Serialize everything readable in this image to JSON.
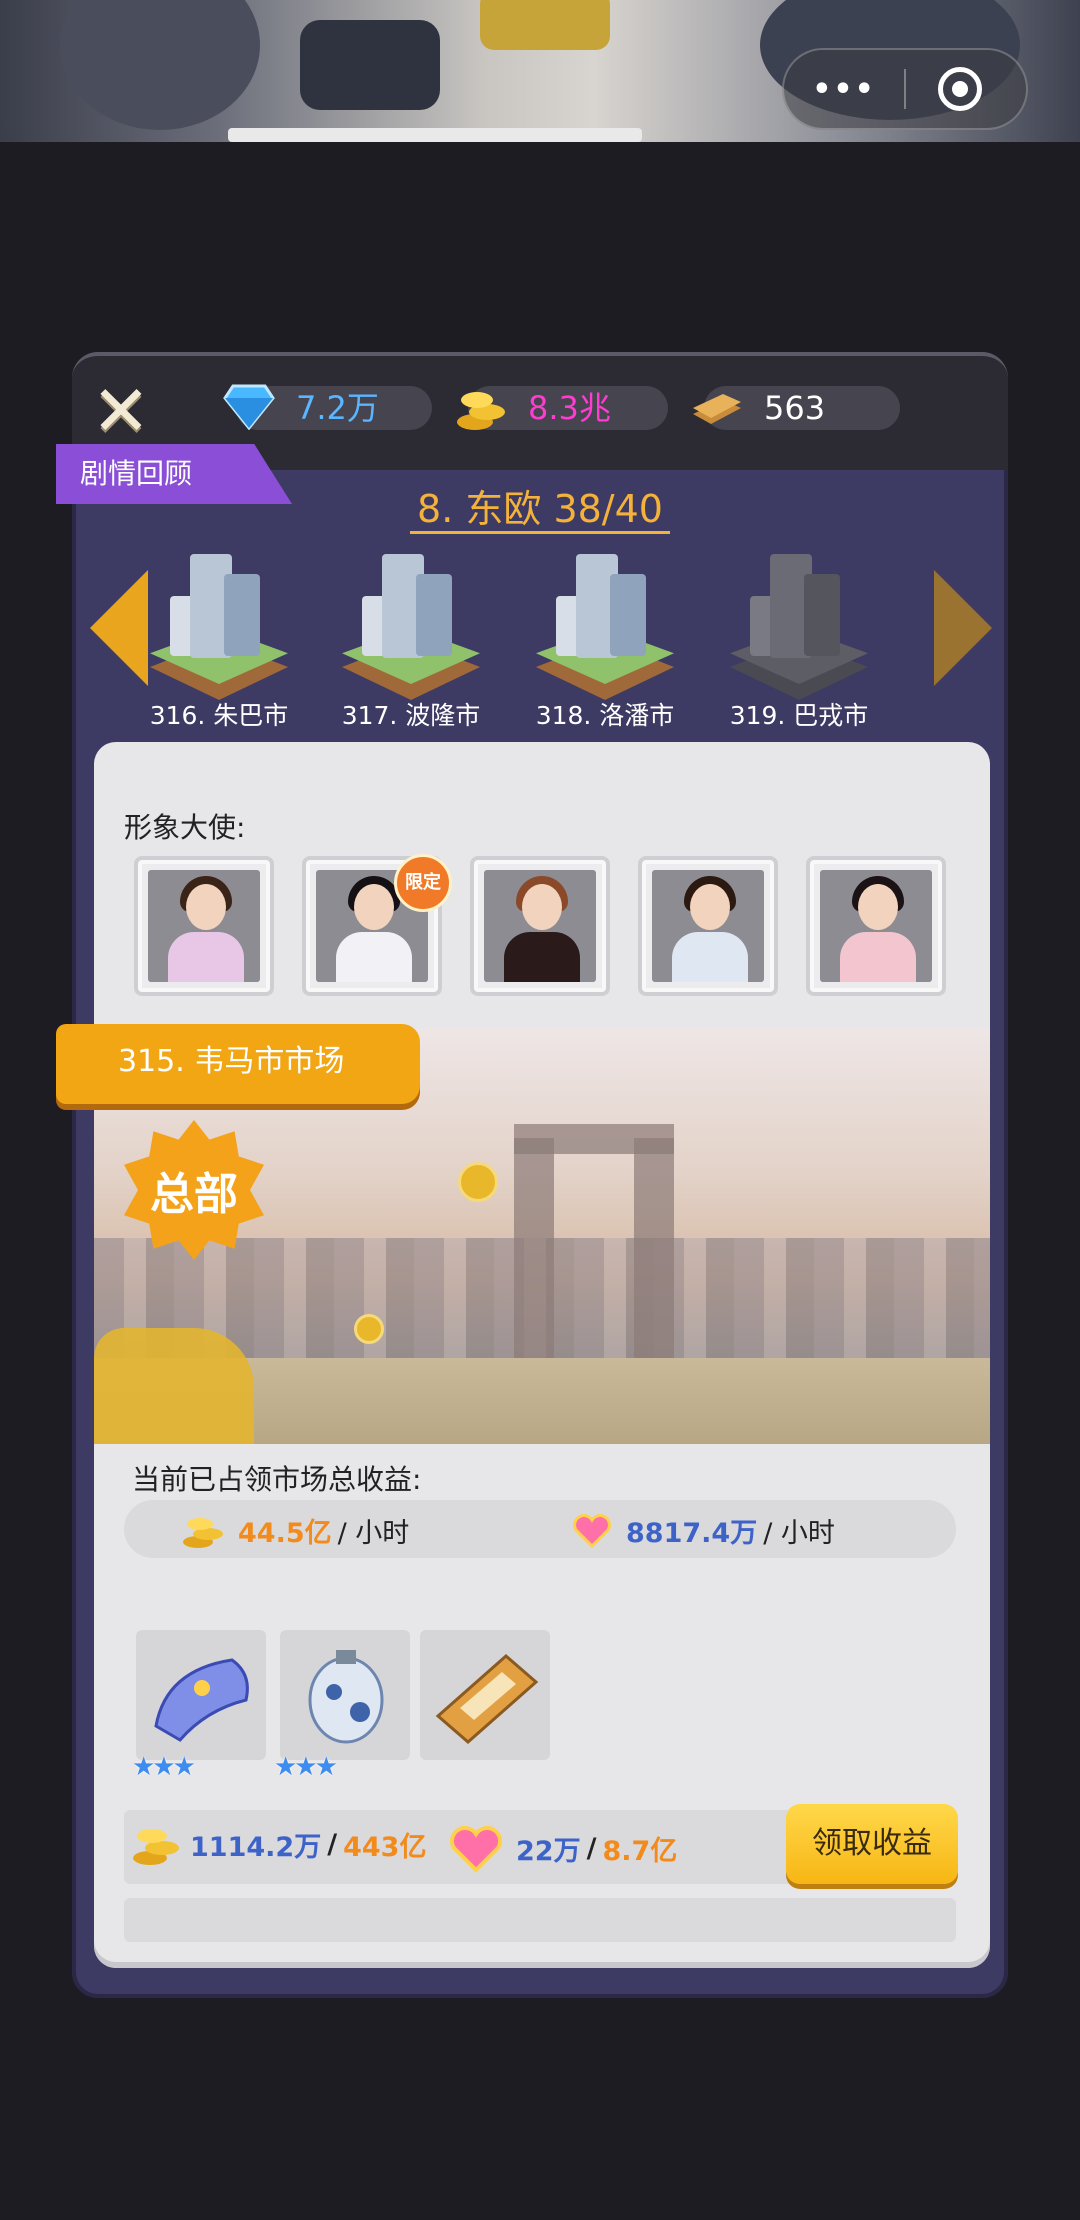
{
  "capsule": {
    "more_label": "•••",
    "icon": "target-icon"
  },
  "resources": {
    "diamond": {
      "icon": "diamond-icon",
      "value": "7.2万"
    },
    "gold": {
      "icon": "gold-coins-icon",
      "value": "8.3兆"
    },
    "ticket": {
      "icon": "gold-bars-icon",
      "value": "563"
    }
  },
  "story_review_label": "剧情回顾",
  "region_title": "8. 东欧 38/40",
  "cities": [
    {
      "label": "316. 朱巴市",
      "locked": false
    },
    {
      "label": "317. 波隆市",
      "locked": false
    },
    {
      "label": "318. 洛潘市",
      "locked": false
    },
    {
      "label": "319. 巴戎市",
      "locked": true
    }
  ],
  "ambassador_title": "形象大使:",
  "ambassadors": [
    {
      "badge": ""
    },
    {
      "badge": "限定"
    },
    {
      "badge": ""
    },
    {
      "badge": ""
    },
    {
      "badge": ""
    }
  ],
  "market_name": "315. 韦马市市场",
  "hq_badge": "总部",
  "income_title": "当前已占领市场总收益:",
  "income": {
    "gold": {
      "value": "44.5亿",
      "unit": "/ 小时"
    },
    "hearts": {
      "value": "8817.4万",
      "unit": "/ 小时"
    }
  },
  "items": [
    {
      "icon": "blue-bracelet-icon",
      "stars": "★★★"
    },
    {
      "icon": "porcelain-vase-icon",
      "stars": "★★★"
    },
    {
      "icon": "movie-script-icon",
      "stars": ""
    }
  ],
  "rewards": {
    "gold": {
      "current": "1114.2万",
      "sep": "/",
      "max": "443亿"
    },
    "hearts": {
      "current": "22万",
      "sep": "/",
      "max": "8.7亿"
    }
  },
  "collect_button_label": "领取收益",
  "colors": {
    "panel": "#3d3a63",
    "accent_orange": "#f3a614",
    "diamond_blue": "#5ab6ff",
    "gold_pink": "#ff3cd0",
    "story_purple": "#8a4fd6"
  }
}
